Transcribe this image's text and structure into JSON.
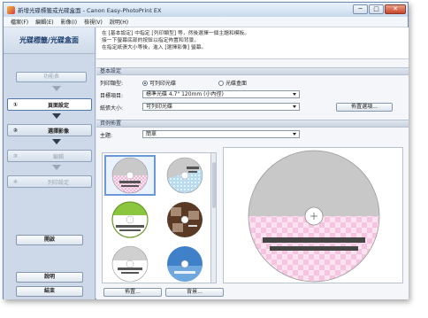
{
  "window": {
    "title": "新增光碟標籤或光碟盒面 - Canon Easy-PhotoPrint EX",
    "minimize": "─",
    "maximize": "□",
    "close": "✕"
  },
  "menu": [
    "檔案(F)",
    "編輯(E)",
    "影像(I)",
    "檢視(V)",
    "說明(H)"
  ],
  "sidebar": {
    "title": "光碟標籤/光碟盒面",
    "menu_button": "功能表",
    "steps": [
      {
        "num": "①",
        "label": "頁面設定",
        "state": "active"
      },
      {
        "num": "②",
        "label": "選擇影像",
        "state": "enabled"
      },
      {
        "num": "③",
        "label": "編輯",
        "state": "disabled"
      },
      {
        "num": "④",
        "label": "列印設定",
        "state": "disabled"
      }
    ],
    "open_button": "開啟",
    "help_button": "說明",
    "exit_button": "結束"
  },
  "intro": {
    "line1": "在 [基本設定] 中指定 [列印類型] 等，然後選擇一個主題和模板。",
    "line2": "接一下螢幕底部的按鈕以指定佈置和背景。",
    "line3": "在指定紙張大小等後，進入 [選擇影像] 螢幕。"
  },
  "basic": {
    "header": "基本設定",
    "print_type_label": "列印類型:",
    "print_type_options": [
      "可列印光碟",
      "光碟盒面"
    ],
    "print_type_selected": 0,
    "target_label": "目標項目:",
    "target_value": "標準光碟 4.7\" 120mm (小內徑)",
    "paper_label": "紙張大小:",
    "paper_value": "可列印光碟",
    "layout_button": "佈置選項..."
  },
  "layout": {
    "header": "資例佈置",
    "theme_label": "主題:",
    "theme_value": "簡單",
    "layout_button": "佈置...",
    "background_button": "背景..."
  },
  "thumbnails": [
    {
      "name": "template-pink-check",
      "selected": true,
      "top": "#c9c9c9",
      "bottom": "#f2b8d8"
    },
    {
      "name": "template-blue-dots",
      "selected": false,
      "top": "#c9c9c9",
      "bottom": "#b9dbf0"
    },
    {
      "name": "template-green-band",
      "selected": false,
      "top": "#8cc63f",
      "bottom": "#ffffff"
    },
    {
      "name": "template-brown-photo",
      "selected": false,
      "top": "#5a3a25",
      "bottom": "#5a3a25"
    },
    {
      "name": "template-gray-plain",
      "selected": false,
      "top": "#d0d0d0",
      "bottom": "#ffffff"
    },
    {
      "name": "template-sky-photo",
      "selected": false,
      "top": "#3f80c9",
      "bottom": "#3f80c9"
    }
  ],
  "colors": {
    "accent": "#1c3f6e",
    "disc_gray": "#c8c8c8",
    "disc_pink": "#f6c4e0",
    "text_bar": "#444444"
  }
}
